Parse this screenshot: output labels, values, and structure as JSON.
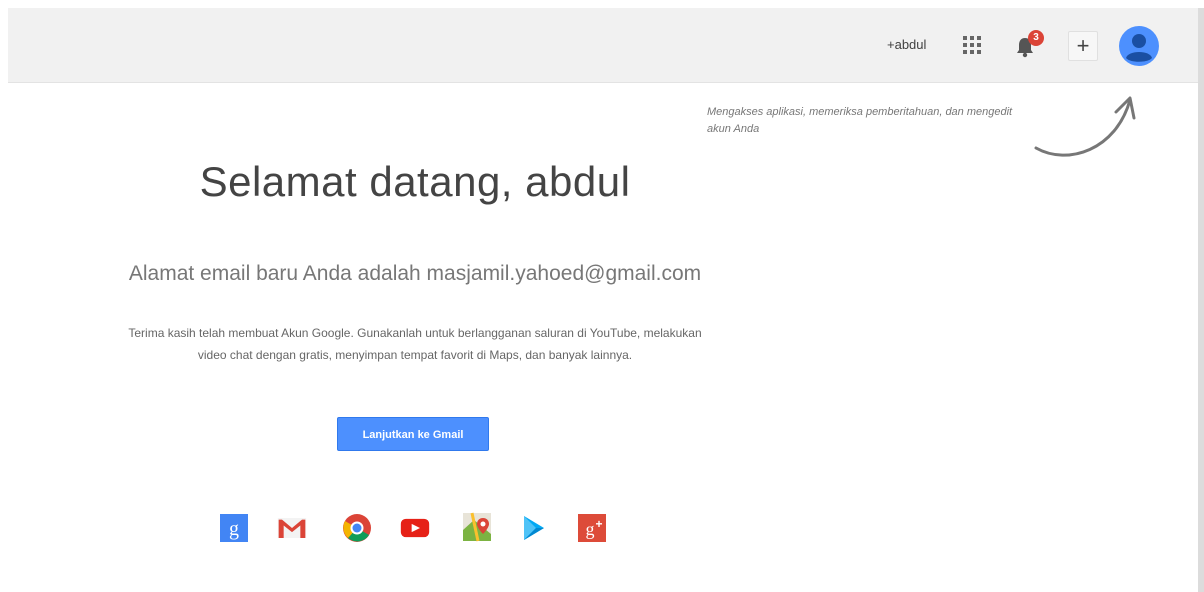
{
  "header": {
    "user_link": "+abdul",
    "notification_count": "3",
    "add_label": "+",
    "icons": {
      "apps": "apps-grid-icon",
      "notifications": "bell-icon",
      "account": "account-avatar-icon"
    }
  },
  "tip": {
    "text": "Mengakses aplikasi, memeriksa pemberitahuan, dan mengedit akun Anda"
  },
  "main": {
    "welcome": "Selamat datang, abdul",
    "email_message": "Alamat email baru Anda adalah masjamil.yahoed@gmail.com",
    "thanks_line1": "Terima kasih telah membuat Akun Google. Gunakanlah untuk berlangganan saluran di YouTube, melakukan",
    "thanks_line2": "video chat dengan gratis, menyimpan tempat favorit di Maps, dan banyak lainnya.",
    "continue_button": "Lanjutkan ke Gmail"
  },
  "products": [
    {
      "name": "google-search-icon",
      "letter": "g",
      "color": "#4285f4"
    },
    {
      "name": "gmail-icon",
      "letter": "",
      "color": "#db4437"
    },
    {
      "name": "chrome-icon",
      "letter": "",
      "color": "#0f9d58"
    },
    {
      "name": "youtube-icon",
      "letter": "",
      "color": "#e62117"
    },
    {
      "name": "maps-icon",
      "letter": "",
      "color": "#7cb342"
    },
    {
      "name": "play-store-icon",
      "letter": "",
      "color": "#03a9f4"
    },
    {
      "name": "google-plus-icon",
      "letter": "g+",
      "color": "#dd4b39"
    }
  ],
  "colors": {
    "accent_blue": "#4d90fe",
    "badge_red": "#db4437",
    "topbar_bg": "#f1f1f1"
  }
}
